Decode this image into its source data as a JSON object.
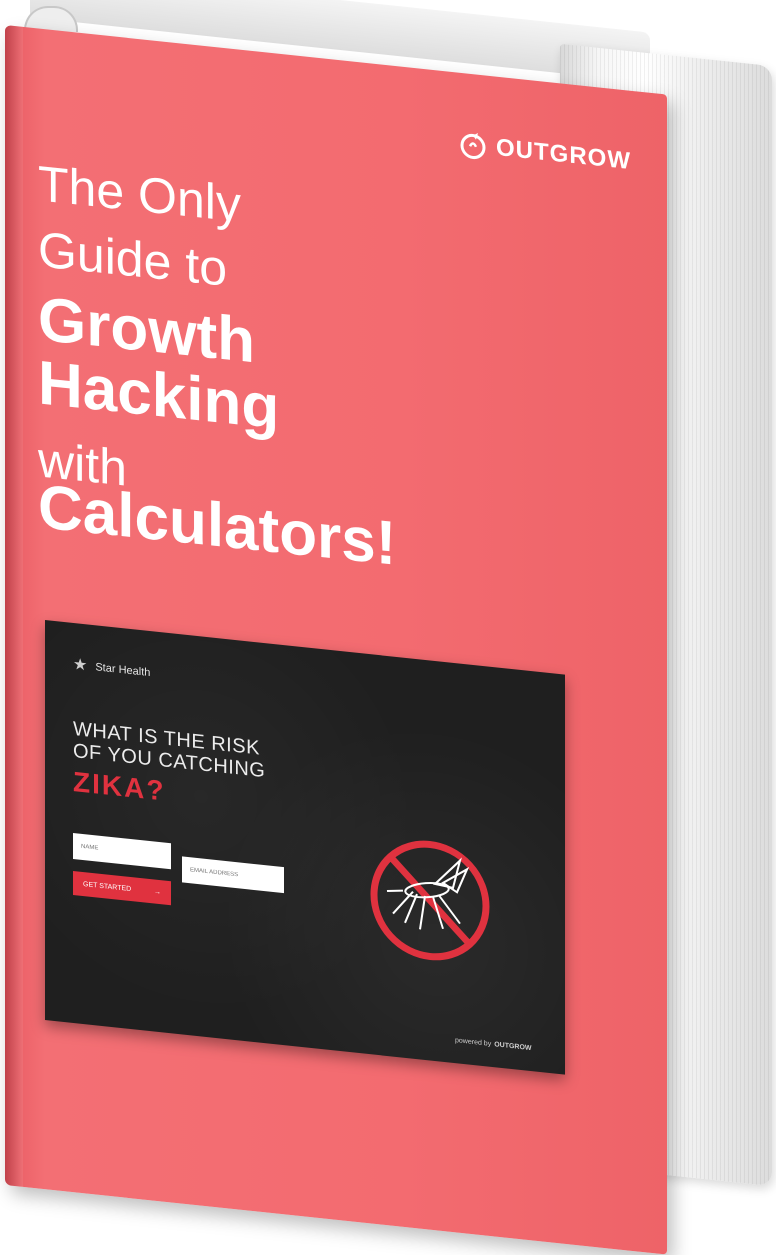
{
  "brand": {
    "name": "OUTGROW",
    "logo_icon": "outgrow-logo-icon"
  },
  "title": {
    "line1": "The Only",
    "line2": "Guide to",
    "line3": "Growth",
    "line4": "Hacking",
    "line5": "with",
    "line6": "Calculators!"
  },
  "card": {
    "brand": "Star Health",
    "brand_icon": "star-icon",
    "question": "WHAT IS THE RISK OF YOU CATCHING",
    "highlight": "ZIKA?",
    "name_placeholder": "NAME",
    "email_placeholder": "EMAIL ADDRESS",
    "button_label": "GET STARTED",
    "button_icon": "arrow-right-icon",
    "powered_by": "powered by",
    "powered_brand": "OUTGROW",
    "image_icon": "no-mosquito-icon"
  },
  "colors": {
    "cover": "#f36b70",
    "card_bg": "#1f1f1f",
    "accent_red": "#e0323f",
    "text_white": "#ffffff"
  }
}
